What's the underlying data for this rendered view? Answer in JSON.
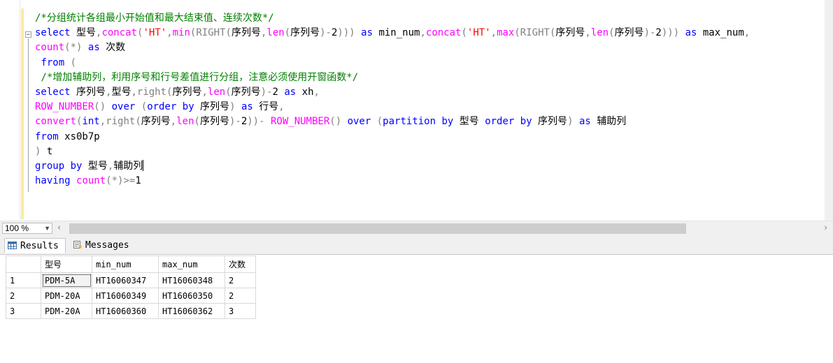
{
  "editor": {
    "lines": [
      [
        [
          "cm",
          "/*分组统计各组最小开始值和最大结束值、连续次数*/"
        ]
      ],
      [
        [
          "kw",
          "select"
        ],
        [
          "",
          " 型号"
        ],
        [
          "op",
          ","
        ],
        [
          "fn",
          "concat"
        ],
        [
          "op",
          "("
        ],
        [
          "st",
          "'HT'"
        ],
        [
          "op",
          ","
        ],
        [
          "fn",
          "min"
        ],
        [
          "op",
          "("
        ],
        [
          "op",
          "RIGHT"
        ],
        [
          "op",
          "("
        ],
        [
          "",
          "序列号"
        ],
        [
          "op",
          ","
        ],
        [
          "fn",
          "len"
        ],
        [
          "op",
          "("
        ],
        [
          "",
          "序列号"
        ],
        [
          "op",
          ")-"
        ],
        [
          "",
          "2"
        ],
        [
          "op",
          ")))"
        ],
        [
          "",
          " "
        ],
        [
          "kw",
          "as"
        ],
        [
          "",
          " min_num"
        ],
        [
          "op",
          ","
        ],
        [
          "fn",
          "concat"
        ],
        [
          "op",
          "("
        ],
        [
          "st",
          "'HT'"
        ],
        [
          "op",
          ","
        ],
        [
          "fn",
          "max"
        ],
        [
          "op",
          "("
        ],
        [
          "op",
          "RIGHT"
        ],
        [
          "op",
          "("
        ],
        [
          "",
          "序列号"
        ],
        [
          "op",
          ","
        ],
        [
          "fn",
          "len"
        ],
        [
          "op",
          "("
        ],
        [
          "",
          "序列号"
        ],
        [
          "op",
          ")-"
        ],
        [
          "",
          "2"
        ],
        [
          "op",
          ")))"
        ],
        [
          "",
          " "
        ],
        [
          "kw",
          "as"
        ],
        [
          "",
          " max_num"
        ],
        [
          "op",
          ","
        ]
      ],
      [
        [
          "fn",
          "count"
        ],
        [
          "op",
          "(*)"
        ],
        [
          "",
          " "
        ],
        [
          "kw",
          "as"
        ],
        [
          "",
          " 次数"
        ]
      ],
      [
        [
          "",
          " "
        ],
        [
          "kw",
          "from"
        ],
        [
          "",
          " "
        ],
        [
          "op",
          "("
        ]
      ],
      [
        [
          "",
          " "
        ],
        [
          "cm",
          "/*增加辅助列，利用序号和行号差值进行分组，注意必须使用开窗函数*/"
        ]
      ],
      [
        [
          "kw",
          "select"
        ],
        [
          "",
          " 序列号"
        ],
        [
          "op",
          ","
        ],
        [
          "",
          "型号"
        ],
        [
          "op",
          ","
        ],
        [
          "op",
          "right"
        ],
        [
          "op",
          "("
        ],
        [
          "",
          "序列号"
        ],
        [
          "op",
          ","
        ],
        [
          "fn",
          "len"
        ],
        [
          "op",
          "("
        ],
        [
          "",
          "序列号"
        ],
        [
          "op",
          ")-"
        ],
        [
          "",
          "2 "
        ],
        [
          "kw",
          "as"
        ],
        [
          "",
          " xh"
        ],
        [
          "op",
          ","
        ]
      ],
      [
        [
          "fn",
          "ROW_NUMBER"
        ],
        [
          "op",
          "()"
        ],
        [
          "",
          " "
        ],
        [
          "kw",
          "over"
        ],
        [
          "",
          " "
        ],
        [
          "op",
          "("
        ],
        [
          "kw",
          "order by"
        ],
        [
          "",
          " 序列号"
        ],
        [
          "op",
          ")"
        ],
        [
          "",
          " "
        ],
        [
          "kw",
          "as"
        ],
        [
          "",
          " 行号"
        ],
        [
          "op",
          ","
        ]
      ],
      [
        [
          "fn",
          "convert"
        ],
        [
          "op",
          "("
        ],
        [
          "kw",
          "int"
        ],
        [
          "op",
          ","
        ],
        [
          "op",
          "right"
        ],
        [
          "op",
          "("
        ],
        [
          "",
          "序列号"
        ],
        [
          "op",
          ","
        ],
        [
          "fn",
          "len"
        ],
        [
          "op",
          "("
        ],
        [
          "",
          "序列号"
        ],
        [
          "op",
          ")-"
        ],
        [
          "",
          "2"
        ],
        [
          "op",
          "))-"
        ],
        [
          "",
          " "
        ],
        [
          "fn",
          "ROW_NUMBER"
        ],
        [
          "op",
          "()"
        ],
        [
          "",
          " "
        ],
        [
          "kw",
          "over"
        ],
        [
          "",
          " "
        ],
        [
          "op",
          "("
        ],
        [
          "kw",
          "partition by"
        ],
        [
          "",
          " 型号 "
        ],
        [
          "kw",
          "order by"
        ],
        [
          "",
          " 序列号"
        ],
        [
          "op",
          ")"
        ],
        [
          "",
          " "
        ],
        [
          "kw",
          "as"
        ],
        [
          "",
          " 辅助列"
        ]
      ],
      [
        [
          "kw",
          "from"
        ],
        [
          "",
          " xs0b7p"
        ]
      ],
      [
        [
          "op",
          ")"
        ],
        [
          "",
          " t"
        ]
      ],
      [
        [
          "kw",
          "group by"
        ],
        [
          "",
          " 型号"
        ],
        [
          "op",
          ","
        ],
        [
          "",
          "辅助列"
        ]
      ],
      [
        [
          "kw",
          "having"
        ],
        [
          "",
          " "
        ],
        [
          "fn",
          "count"
        ],
        [
          "op",
          "(*)>="
        ],
        [
          "",
          "1"
        ]
      ]
    ]
  },
  "zoom": {
    "value": "100 %"
  },
  "tabs": {
    "results": "Results",
    "messages": "Messages"
  },
  "grid": {
    "columns": [
      "型号",
      "min_num",
      "max_num",
      "次数"
    ],
    "rows": [
      {
        "n": "1",
        "cells": [
          "PDM-5A",
          "HT16060347",
          "HT16060348",
          "2"
        ]
      },
      {
        "n": "2",
        "cells": [
          "PDM-20A",
          "HT16060349",
          "HT16060350",
          "2"
        ]
      },
      {
        "n": "3",
        "cells": [
          "PDM-20A",
          "HT16060360",
          "HT16060362",
          "3"
        ]
      }
    ]
  },
  "colors": {
    "comment": "#008000",
    "keyword": "#0000ff",
    "function": "#ff00ff",
    "string": "#ff0000",
    "operator": "#808080",
    "change_bar": "#fbec9a"
  }
}
